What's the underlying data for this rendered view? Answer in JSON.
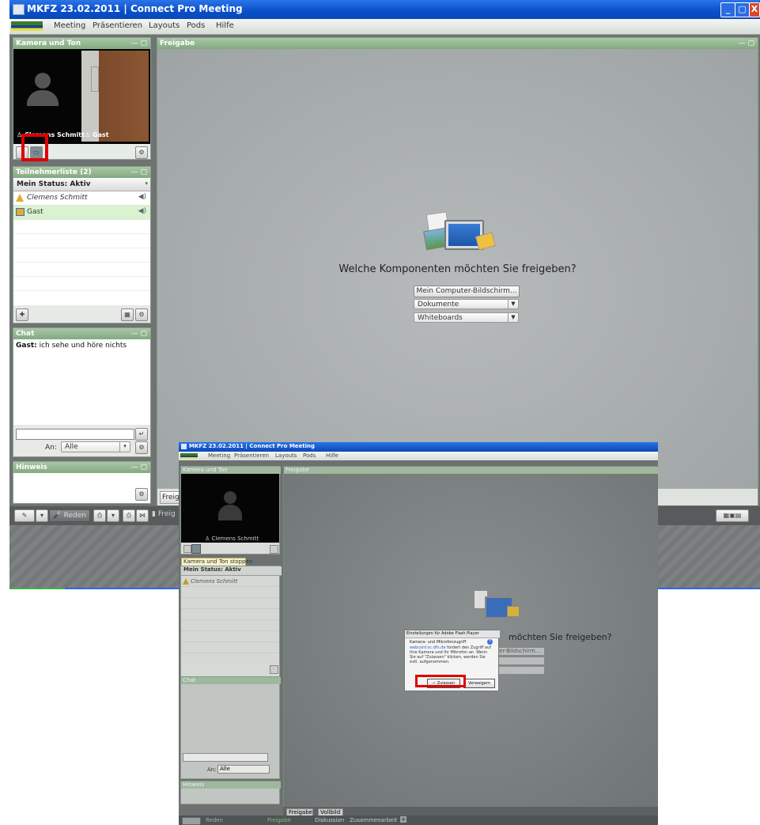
{
  "window": {
    "title": "MKFZ 23.02.2011 | Connect Pro Meeting",
    "controls": [
      "_",
      "▢",
      "X"
    ]
  },
  "menu": [
    "Meeting",
    "Präsentieren",
    "Layouts",
    "Pods",
    "Hilfe"
  ],
  "camera_pod": {
    "title": "Kamera und Ton",
    "participants": [
      "Clemens Schmitt",
      "Gast"
    ]
  },
  "attendee_pod": {
    "title": "Teilnehmerliste (2)",
    "status": "Mein Status: Aktiv",
    "attendees": [
      {
        "name": "Clemens Schmitt",
        "role": "host"
      },
      {
        "name": "Gast",
        "role": "guest"
      }
    ]
  },
  "share_pod": {
    "title": "Freigabe",
    "question": "Welche Komponenten möchten Sie freigeben?",
    "button": "Mein Computer-Bildschirm...",
    "dropdowns": [
      "Dokumente",
      "Whiteboards"
    ],
    "bottom_tab": "Freig"
  },
  "chat_pod": {
    "title": "Chat",
    "message_sender": "Gast:",
    "message_text": " ich sehe und höre nichts",
    "to_label": "An:",
    "to_value": "Alle"
  },
  "notes_pod": {
    "title": "Hinweis"
  },
  "bottombar": {
    "speak": "Reden",
    "share_tab": "Freig"
  },
  "second_window": {
    "title": "MKFZ 23.02.2011 | Connect Pro Meeting",
    "menu": [
      "Meeting",
      "Präsentieren",
      "Layouts",
      "Pods",
      "Hilfe"
    ],
    "camera_title": "Kamera und Ton",
    "camera_person": "Clemens Schmitt",
    "tooltip": "Kamera und Ton stoppen",
    "status": "Mein Status: Aktiv",
    "attendee": "Clemens Schmitt",
    "share_title": "Freigabe",
    "question_partial": "möchten Sie freigeben?",
    "share_button_partial": "uter-Bildschirm...",
    "chat_title": "Chat",
    "chat_to_label": "An:",
    "chat_to_value": "Alle",
    "notes_title": "Hinweis",
    "share_tabs": [
      "Freigabe",
      "Vollbild"
    ],
    "bottom_tabs": [
      "Freigabe",
      "Diskussion",
      "Zusammenarbeit"
    ],
    "speak": "Reden",
    "dialog": {
      "title": "Einstellungen für Adobe Flash Player",
      "heading": "Kamera- und Mikrofonzugriff",
      "body_link": "webconf.vc.dfn.de",
      "body_rest": " fordert den Zugriff auf Ihre Kamera und Ihr Mikrofon an. Wenn Sie auf \"Zulassen\" klicken, werden Sie evtl. aufgenommen.",
      "allow": "Zulassen",
      "deny": "Verweigern"
    }
  },
  "colors": {
    "titlebar": "#0a4fc9",
    "pod_header": "#83a980",
    "highlight_row": "#d9f2cf",
    "annotation_red": "#e00000",
    "stage": "#a9adad"
  }
}
